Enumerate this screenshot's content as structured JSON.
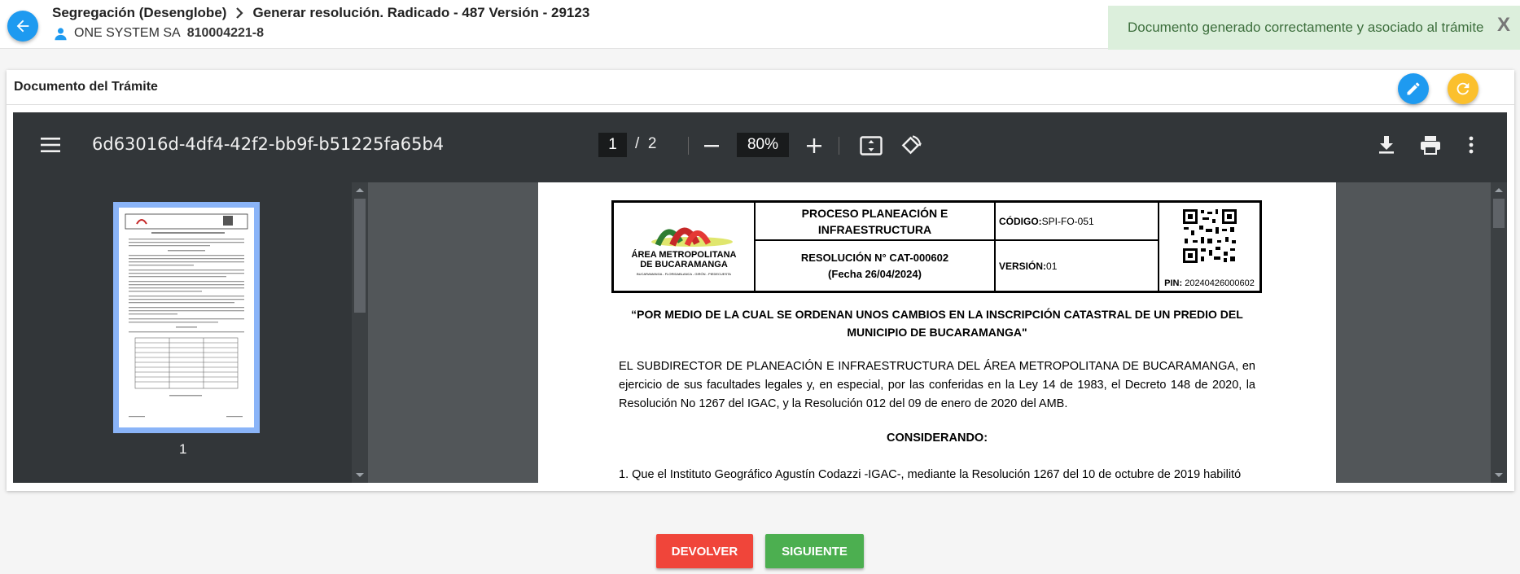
{
  "header": {
    "breadcrumb_parent": "Segregación (Desenglobe)",
    "breadcrumb_current": "Generar resolución. Radicado - 487 Versión - 29123",
    "company_name": "ONE SYSTEM SA",
    "company_nit": "810004221-8"
  },
  "toast": {
    "message": "Documento generado correctamente y asociado al trámite",
    "close_label": "X"
  },
  "card": {
    "title": "Documento del Trámite"
  },
  "viewer": {
    "file_name": "6d63016d-4df4-42f2-bb9f-b51225fa65b4",
    "current_page": "1",
    "page_separator": "/",
    "total_pages": "2",
    "zoom": "80%",
    "thumbnail_label": "1"
  },
  "document": {
    "header": {
      "process": "PROCESO PLANEACIÓN E INFRAESTRUCTURA",
      "resolution": "RESOLUCIÓN N° CAT-000602",
      "date": "(Fecha 26/04/2024)",
      "code_label": "CÓDIGO:",
      "code_value": "SPI-FO-051",
      "version_label": "VERSIÓN:",
      "version_value": "01",
      "pin_label": "PIN:",
      "pin_value": "20240426000602",
      "logo_name_1": "ÁREA METROPOLITANA",
      "logo_name_2": "DE BUCARAMANGA",
      "logo_sub": "BUCARAMANGA - FLORIDABLANCA - GIRÓN - PIEDECUESTA"
    },
    "title": "“POR MEDIO DE LA CUAL SE ORDENAN UNOS CAMBIOS EN LA INSCRIPCIÓN CATASTRAL DE UN PREDIO DEL MUNICIPIO DE BUCARAMANGA\"",
    "paragraph": "EL SUBDIRECTOR DE PLANEACIÓN E INFRAESTRUCTURA DEL ÁREA METROPOLITANA DE BUCARAMANGA, en ejercicio de sus facultades legales y, en especial, por las conferidas en la Ley 14 de 1983, el Decreto 148 de 2020, la Resolución No 1267 del IGAC, y la Resolución 012 del 09 de enero de 2020 del AMB.",
    "heading": "CONSIDERANDO:",
    "item_1": "1. Que el Instituto Geográfico Agustín Codazzi -IGAC-, mediante la Resolución 1267 del 10 de octubre de 2019 habilitó"
  },
  "actions": {
    "devolver_label": "DEVOLVER",
    "siguiente_label": "SIGUIENTE"
  },
  "colors": {
    "primary": "#1e9af0",
    "warning": "#fbc02d",
    "danger": "#f0453a",
    "success": "#4caf50",
    "toast_bg": "#dcefdc"
  }
}
